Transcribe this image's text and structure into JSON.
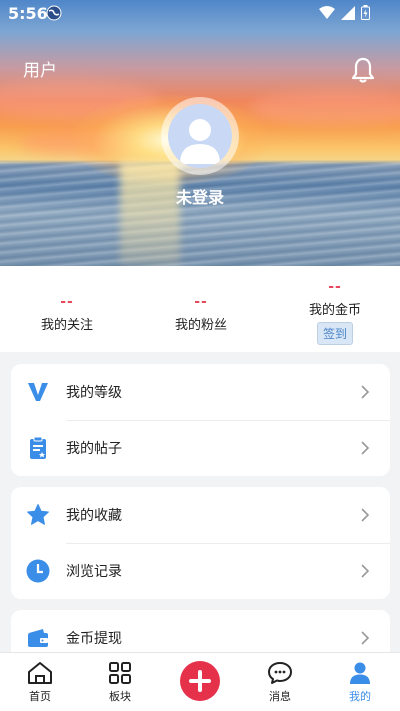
{
  "status_bar": {
    "time": "5:56"
  },
  "header": {
    "title": "用户",
    "login_status": "未登录"
  },
  "stats": [
    {
      "count": "--",
      "label": "我的关注"
    },
    {
      "count": "--",
      "label": "我的粉丝"
    },
    {
      "count": "--",
      "label": "我的金币",
      "action": "签到"
    }
  ],
  "menu_groups": [
    {
      "items": [
        {
          "label": "我的等级",
          "icon": "v-level-icon"
        },
        {
          "label": "我的帖子",
          "icon": "clipboard-icon"
        }
      ]
    },
    {
      "items": [
        {
          "label": "我的收藏",
          "icon": "star-icon"
        },
        {
          "label": "浏览记录",
          "icon": "clock-icon"
        }
      ]
    },
    {
      "items": [
        {
          "label": "金币提现",
          "icon": "wallet-icon"
        }
      ]
    }
  ],
  "bottom_nav": {
    "items": [
      {
        "label": "首页",
        "icon": "home-icon"
      },
      {
        "label": "板块",
        "icon": "grid-icon"
      },
      {
        "label": "",
        "icon": "add-icon"
      },
      {
        "label": "消息",
        "icon": "chat-icon"
      },
      {
        "label": "我的",
        "icon": "person-icon"
      }
    ],
    "active_index": 4
  },
  "colors": {
    "accent": "#3b8ee8",
    "count_red": "#e5495d",
    "add_button": "#e5314a"
  }
}
